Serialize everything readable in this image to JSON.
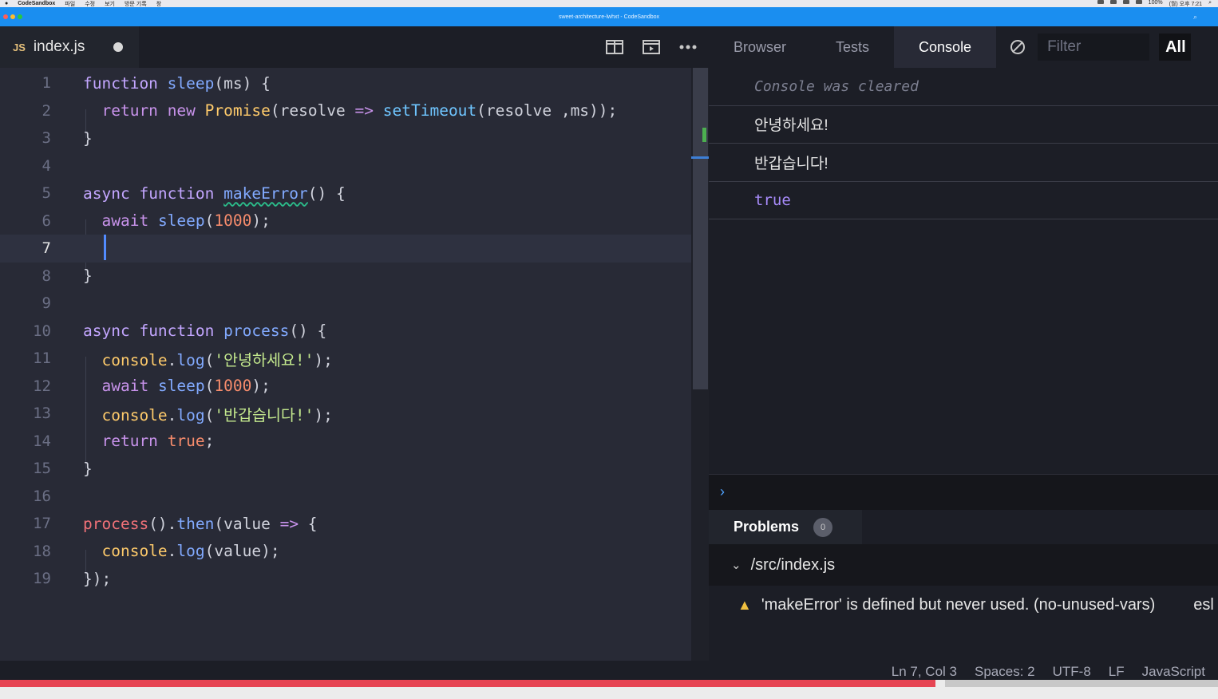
{
  "menubar": {
    "app_name": "CodeSandbox",
    "menus": [
      "파일",
      "수정",
      "보기",
      "방문 기록",
      "창"
    ],
    "battery": "100%",
    "clock": "(월) 오후 7:21"
  },
  "window": {
    "title": "sweet-architecture-lwhxt - CodeSandbox"
  },
  "editor": {
    "file_badge": "JS",
    "file_name": "index.js",
    "current_line": 7,
    "line_numbers": [
      "1",
      "2",
      "3",
      "4",
      "5",
      "6",
      "7",
      "8",
      "9",
      "10",
      "11",
      "12",
      "13",
      "14",
      "15",
      "16",
      "17",
      "18",
      "19"
    ]
  },
  "right_pane": {
    "tabs": [
      "Browser",
      "Tests",
      "Console"
    ],
    "active_tab": "Console",
    "filter_placeholder": "Filter",
    "level_select": "All"
  },
  "console": {
    "messages": [
      "Console was cleared",
      "안녕하세요!",
      "반갑습니다!",
      "true"
    ],
    "prompt": "›"
  },
  "problems": {
    "label": "Problems",
    "count": "0",
    "file": "/src/index.js",
    "warning": "'makeError' is defined but never used. (no-unused-vars)",
    "source": "esl"
  },
  "statusbar": {
    "position": "Ln 7, Col 3",
    "spaces": "Spaces: 2",
    "encoding": "UTF-8",
    "eol": "LF",
    "language": "JavaScript"
  },
  "video_progress": {
    "played_fraction": 0.768,
    "buffered_fraction": 1.0
  },
  "colors": {
    "title_bar": "#1a8ef0",
    "editor_bg": "#282a36",
    "progress": "#e64553",
    "warning": "#f0c040"
  },
  "icons": [
    "split-view-icon",
    "preview-icon",
    "more-icon",
    "clear-console-icon",
    "chevron-right-icon",
    "chevron-down-icon",
    "warning-icon"
  ]
}
